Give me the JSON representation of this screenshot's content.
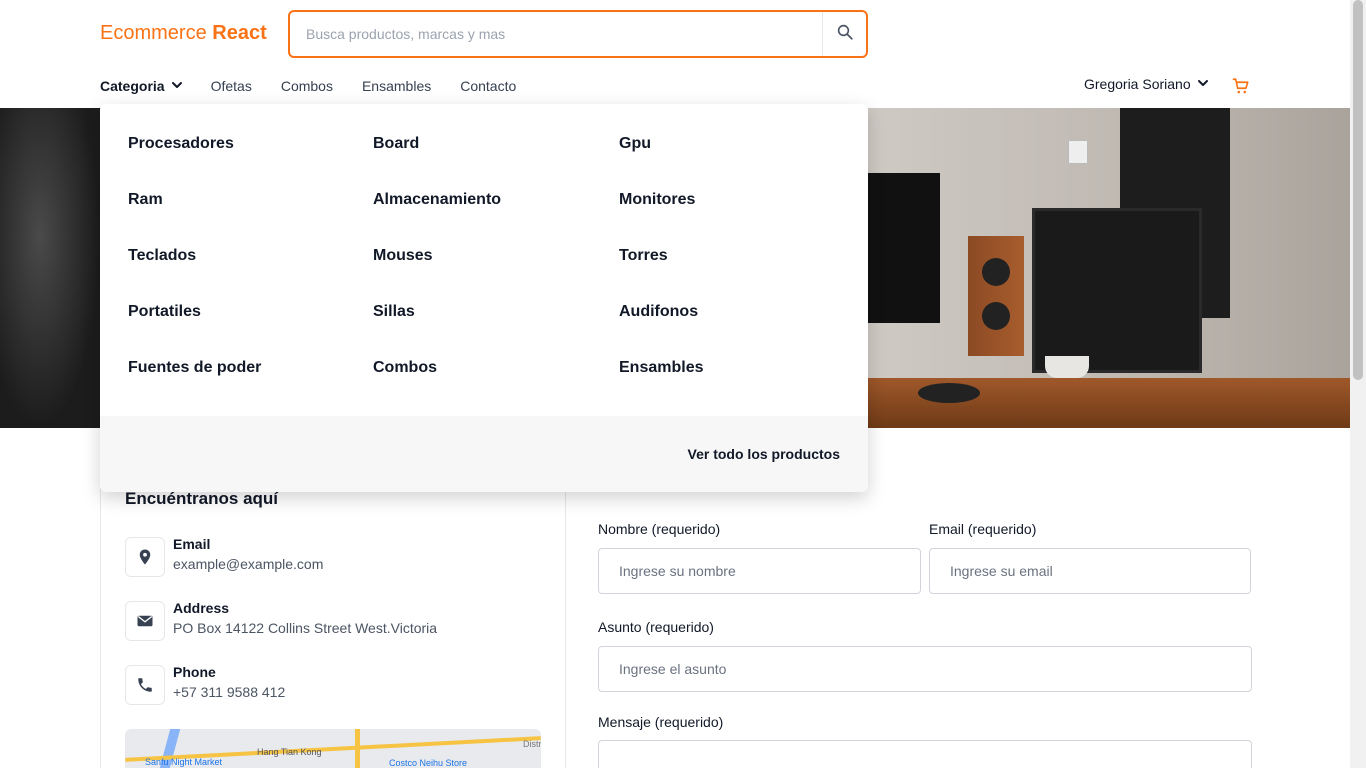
{
  "header": {
    "logo_text": "Ecommerce",
    "logo_strong": "React",
    "search_placeholder": "Busca productos, marcas y mas",
    "search_icon": "search-icon"
  },
  "nav": {
    "category_label": "Categoria",
    "links": [
      "Ofetas",
      "Combos",
      "Ensambles",
      "Contacto"
    ],
    "user_name": "Gregoria Soriano",
    "cart_icon": "cart-icon"
  },
  "dropdown": {
    "items": [
      "Procesadores",
      "Board",
      "Gpu",
      "Ram",
      "Almacenamiento",
      "Monitores",
      "Teclados",
      "Mouses",
      "Torres",
      "Portatiles",
      "Sillas",
      "Audifonos",
      "Fuentes de poder",
      "Combos",
      "Ensambles"
    ],
    "view_all": "Ver todo los productos"
  },
  "contact": {
    "title": "Encuéntranos aquí",
    "email_label": "Email",
    "email_value": "example@example.com",
    "address_label": "Address",
    "address_value": "PO Box 14122 Collins Street West.Victoria",
    "phone_label": "Phone",
    "phone_value": "+57 311 9588 412",
    "map_labels": [
      "Hang Tian Kong",
      "Sanfu Night Market",
      "Costco Neihu Store",
      "Distr de Ne"
    ]
  },
  "form": {
    "name_label": "Nombre (requerido)",
    "name_placeholder": "Ingrese su nombre",
    "email_label": "Email (requerido)",
    "email_placeholder": "Ingrese su email",
    "subject_label": "Asunto (requerido)",
    "subject_placeholder": "Ingrese el asunto",
    "message_label": "Mensaje (requerido)"
  },
  "colors": {
    "accent": "#f97316",
    "text": "#111827",
    "muted": "#6b7280"
  }
}
